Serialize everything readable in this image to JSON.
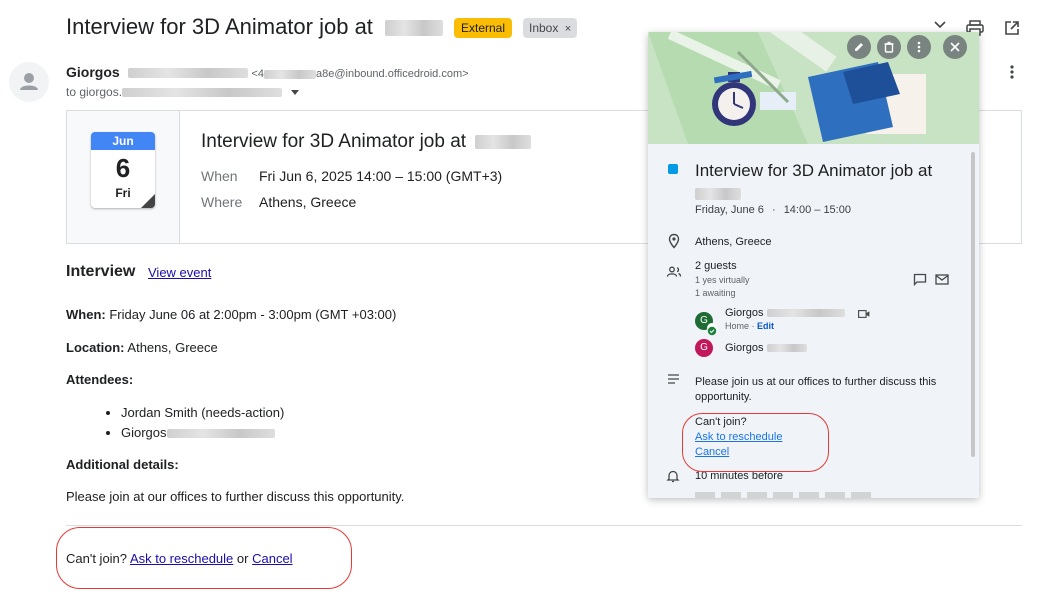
{
  "email": {
    "subject": "Interview for 3D Animator job at",
    "badges": {
      "external": "External",
      "inbox": "Inbox",
      "inbox_close": "×"
    },
    "sender": {
      "name": "Giorgos",
      "email_prefix": "<4",
      "email_suffix": "a8e@inbound.officedroid.com>",
      "to": "to giorgos."
    }
  },
  "invite": {
    "month": "Jun",
    "day": "6",
    "dow": "Fri",
    "title": "Interview for 3D Animator job at",
    "when_label": "When",
    "when_value": "Fri Jun 6, 2025 14:00 – 15:00 (GMT+3)",
    "where_label": "Where",
    "where_value": "Athens, Greece"
  },
  "body": {
    "heading": "Interview",
    "view_event": "View event",
    "when_label": "When:",
    "when_value": "Friday June 06 at 2:00pm - 3:00pm (GMT +03:00)",
    "location_label": "Location:",
    "location_value": "Athens, Greece",
    "attendees_label": "Attendees:",
    "attendees": [
      "Jordan Smith (needs-action)",
      "Giorgos"
    ],
    "details_label": "Additional details:",
    "details_value": "Please join at our offices to further discuss this opportunity.",
    "footer_prefix": "Can't join?",
    "footer_reschedule": "Ask to reschedule",
    "footer_or": "or",
    "footer_cancel": "Cancel"
  },
  "popup": {
    "title": "Interview for 3D Animator job at",
    "date": "Friday, June 6",
    "dot": "·",
    "time": "14:00 – 15:00",
    "location": "Athens, Greece",
    "guests_count": "2 guests",
    "guests_yes": "1 yes virtually",
    "guests_awaiting": "1 awaiting",
    "guest1": {
      "initial": "G",
      "name": "Giorgos",
      "meta": "Home",
      "meta_dot": "·",
      "edit": "Edit"
    },
    "guest2": {
      "initial": "G",
      "name": "Giorgos"
    },
    "description": "Please join us at our offices to further discuss this opportunity.",
    "cant_join": "Can't join?",
    "ask_reschedule": "Ask to reschedule",
    "cancel": "Cancel",
    "reminder": "10 minutes before",
    "colors": {
      "event": "#039be5",
      "guest1_avatar": "#1e6b34",
      "guest2_avatar": "#c2185b"
    }
  },
  "icons": [
    "expand-icon",
    "print-icon",
    "open-in-new-icon",
    "more-vert-icon",
    "edit-icon",
    "delete-icon",
    "close-icon",
    "location-icon",
    "people-icon",
    "chat-icon",
    "email-icon",
    "video-icon",
    "description-icon",
    "bell-icon",
    "chevron-down-icon"
  ]
}
